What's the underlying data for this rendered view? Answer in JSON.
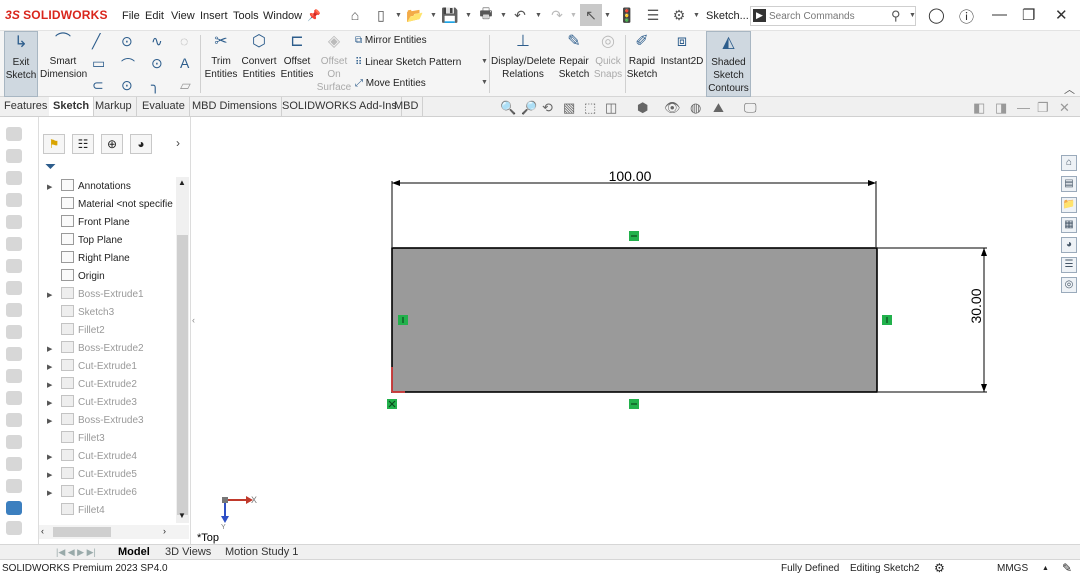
{
  "app": {
    "logo": "SOLIDWORKS",
    "logo_prefix": "3S",
    "menu": [
      "File",
      "Edit",
      "View",
      "Insert",
      "Tools",
      "Window"
    ],
    "document_name": "Sketch...",
    "search_placeholder": "Search Commands"
  },
  "ribbon": {
    "exit_sketch": [
      "Exit",
      "Sketch"
    ],
    "smart_dimension": [
      "Smart",
      "Dimension"
    ],
    "trim_entities": [
      "Trim",
      "Entities"
    ],
    "convert_entities": [
      "Convert",
      "Entities"
    ],
    "offset_entities": [
      "Offset",
      "Entities"
    ],
    "offset_on_surface": [
      "Offset",
      "On",
      "Surface"
    ],
    "mirror_entities": "Mirror Entities",
    "linear_sketch_pattern": "Linear Sketch Pattern",
    "move_entities": "Move Entities",
    "display_delete_relations": [
      "Display/Delete",
      "Relations"
    ],
    "repair_sketch": [
      "Repair",
      "Sketch"
    ],
    "quick_snaps": [
      "Quick",
      "Snaps"
    ],
    "rapid_sketch": [
      "Rapid",
      "Sketch"
    ],
    "instant2d": "Instant2D",
    "shaded_sketch_contours": [
      "Shaded",
      "Sketch",
      "Contours"
    ]
  },
  "tabs": [
    "Features",
    "Sketch",
    "Markup",
    "Evaluate",
    "MBD Dimensions",
    "SOLIDWORKS Add-Ins",
    "MBD"
  ],
  "active_tab": "Sketch",
  "tree": {
    "items": [
      {
        "label": "Annotations",
        "dim": false,
        "expandable": true
      },
      {
        "label": "Material <not specifie",
        "dim": false,
        "expandable": false
      },
      {
        "label": "Front Plane",
        "dim": false,
        "expandable": false
      },
      {
        "label": "Top Plane",
        "dim": false,
        "expandable": false
      },
      {
        "label": "Right Plane",
        "dim": false,
        "expandable": false
      },
      {
        "label": "Origin",
        "dim": false,
        "expandable": false
      },
      {
        "label": "Boss-Extrude1",
        "dim": true,
        "expandable": true
      },
      {
        "label": "Sketch3",
        "dim": true,
        "expandable": false
      },
      {
        "label": "Fillet2",
        "dim": true,
        "expandable": false
      },
      {
        "label": "Boss-Extrude2",
        "dim": true,
        "expandable": true
      },
      {
        "label": "Cut-Extrude1",
        "dim": true,
        "expandable": true
      },
      {
        "label": "Cut-Extrude2",
        "dim": true,
        "expandable": true
      },
      {
        "label": "Cut-Extrude3",
        "dim": true,
        "expandable": true
      },
      {
        "label": "Boss-Extrude3",
        "dim": true,
        "expandable": true
      },
      {
        "label": "Fillet3",
        "dim": true,
        "expandable": false
      },
      {
        "label": "Cut-Extrude4",
        "dim": true,
        "expandable": true
      },
      {
        "label": "Cut-Extrude5",
        "dim": true,
        "expandable": true
      },
      {
        "label": "Cut-Extrude6",
        "dim": true,
        "expandable": true
      },
      {
        "label": "Fillet4",
        "dim": true,
        "expandable": false
      }
    ]
  },
  "viewport": {
    "dimension_width": "100.00",
    "dimension_height": "30.00",
    "view_label": "*Top",
    "triad_x": "X",
    "triad_y": "Y",
    "sketch_fill": "#9a9a9a",
    "relation_color": "#22b14c",
    "dimension_color": "#000000"
  },
  "bottom_tabs": [
    "Model",
    "3D Views",
    "Motion Study 1"
  ],
  "active_bottom_tab": "Model",
  "status": {
    "product": "SOLIDWORKS Premium 2023 SP4.0",
    "sketch_state": "Fully Defined",
    "editing": "Editing Sketch2",
    "units": "MMGS"
  },
  "colors": {
    "brand": "#d9261c",
    "ribbon_icon": "#2d5d8c"
  }
}
